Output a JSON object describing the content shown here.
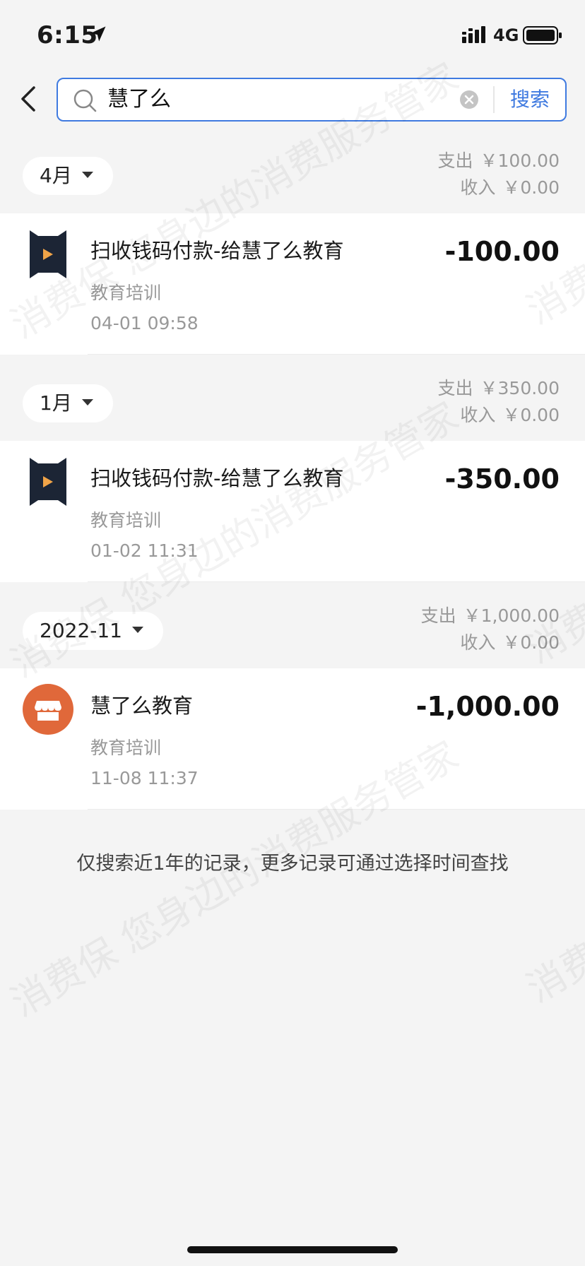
{
  "status_bar": {
    "time": "6:15",
    "network": "4G",
    "icons": [
      "location-arrow-icon",
      "cellular-signal-icon",
      "battery-icon"
    ]
  },
  "search": {
    "query": "慧了么",
    "button_label": "搜索",
    "accent_color": "#3f7ae0"
  },
  "groups": [
    {
      "month_label": "4月",
      "expense_label": "支出",
      "expense_value": "￥100.00",
      "income_label": "收入",
      "income_value": "￥0.00",
      "transactions": [
        {
          "merchant": "扫收钱码付款-给慧了么教育",
          "category": "教育培训",
          "datetime": "04-01 09:58",
          "amount": "-100.00",
          "logo": "play-logo-icon"
        }
      ]
    },
    {
      "month_label": "1月",
      "expense_label": "支出",
      "expense_value": "￥350.00",
      "income_label": "收入",
      "income_value": "￥0.00",
      "transactions": [
        {
          "merchant": "扫收钱码付款-给慧了么教育",
          "category": "教育培训",
          "datetime": "01-02 11:31",
          "amount": "-350.00",
          "logo": "play-logo-icon"
        }
      ]
    },
    {
      "month_label": "2022-11",
      "expense_label": "支出",
      "expense_value": "￥1,000.00",
      "income_label": "收入",
      "income_value": "￥0.00",
      "transactions": [
        {
          "merchant": "慧了么教育",
          "category": "教育培训",
          "datetime": "11-08 11:37",
          "amount": "-1,000.00",
          "logo": "store-icon",
          "logo_color": "#e0683a"
        }
      ]
    }
  ],
  "footer_note": "仅搜索近1年的记录，更多记录可通过选择时间查找",
  "watermark_text": "消费保 您身边的消费服务管家"
}
